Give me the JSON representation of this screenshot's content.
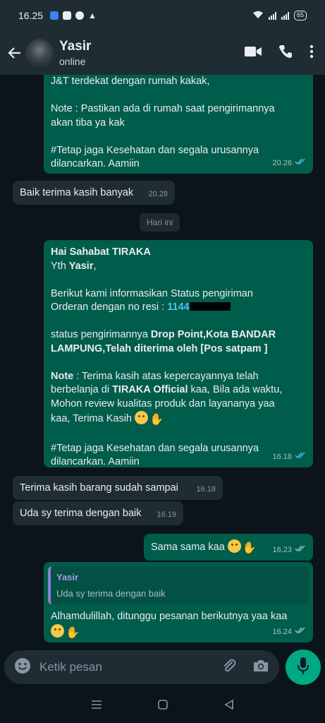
{
  "status_bar": {
    "time": "16.25",
    "battery": "65"
  },
  "header": {
    "contact_name": "Yasir",
    "contact_status": "online"
  },
  "messages": {
    "m1": {
      "lines": [
        "J&T terdekat dengan rumah kakak,",
        "Note : Pastikan ada di rumah saat pengirimannya",
        "akan tiba ya kak",
        "#Tetap jaga Kesehatan dan segala urusannya",
        "dilancarkan. Aamiin"
      ],
      "time": "20.26"
    },
    "m2": {
      "text": "Baik terima kasih banyak",
      "time": "20.28"
    },
    "day_divider": "Hari ini",
    "m3": {
      "greeting": "Hai Sahabat TIRAKA",
      "yth_prefix": "Yth ",
      "yth_name": "Yasir",
      "yth_suffix": ",",
      "info_line1": "Berikut kami informasikan Status pengiriman",
      "info_line2_prefix": "Orderan dengan no resi : ",
      "resi_visible": "1144",
      "status_prefix": "status pengirimannya ",
      "status_bold1": "Drop Point,Kota BANDAR",
      "status_bold2": "LAMPUNG,Telah diterima oleh [Pos satpam ]",
      "note_label": "Note",
      "note_line1_rest": " : Terima kasih atas kepercayannya telah",
      "note_line2_prefix": "berbelanja di ",
      "note_line2_bold": "TIRAKA Official",
      "note_line2_rest": " kaa, Bila ada waktu,",
      "note_line3": "Mohon review kualitas produk dan layananya yaa",
      "note_line4": "kaa, Terima Kasih ",
      "closing_line1": "#Tetap jaga Kesehatan dan segala urusannya",
      "closing_line2": "dilancarkan. Aamiin",
      "time": "16.18"
    },
    "m4": {
      "text": "Terima kasih barang sudah sampai",
      "time": "16.18"
    },
    "m5": {
      "text": "Uda sy terima dengan baik",
      "time": "16.19"
    },
    "m6": {
      "text": "Sama sama kaa ",
      "time": "16.23"
    },
    "m7": {
      "quote_name": "Yasir",
      "quote_text": "Uda sy terima dengan baik",
      "line1": "Alhamdulillah, ditunggu pesanan berikutnya yaa kaa",
      "time": "16.24"
    }
  },
  "composer": {
    "placeholder": "Ketik pesan"
  },
  "colors": {
    "outgoing": "#005c4b",
    "incoming": "#202c33",
    "accent": "#00a884",
    "read_ticks": "#53bdeb"
  }
}
